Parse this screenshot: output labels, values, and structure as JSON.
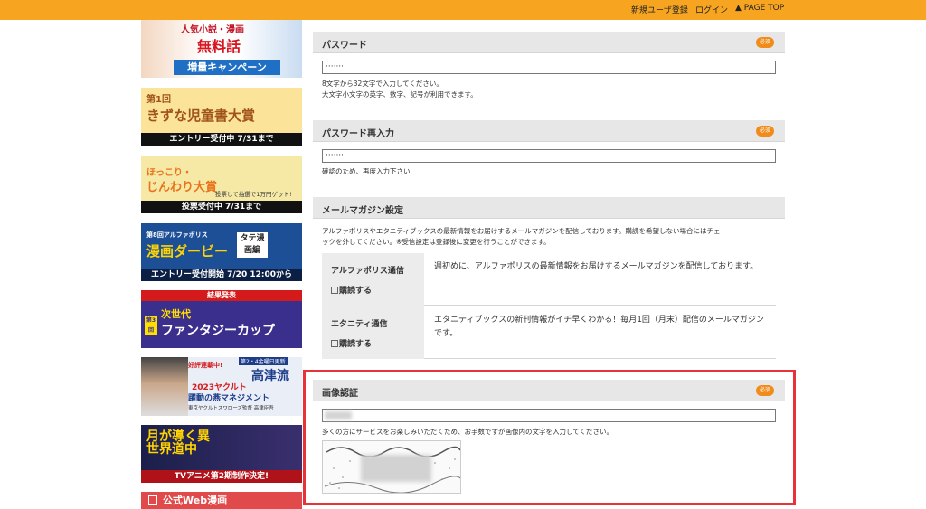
{
  "header": {
    "register": "新規ユーザ登録",
    "login": "ログイン",
    "page_top": "▲ PAGE TOP"
  },
  "sidebar": {
    "banners": [
      {
        "line1": "人気小説・漫画",
        "line2": "無料話",
        "line3": "増量キャンペーン"
      },
      {
        "line1": "第1回",
        "line2": "きずな児童書大賞",
        "footer": "エントリー受付中 7/31まで"
      },
      {
        "line1": "ほっこり・",
        "line2": "じんわり大賞",
        "sub": "投票して抽選で1万円ゲット!",
        "footer": "投票受付中 7/31まで"
      },
      {
        "line1": "第8回アルファポリス",
        "line2": "漫画ダービー",
        "badge": "タテ漫画編",
        "footer": "エントリー受付開始 7/20 12:00から"
      },
      {
        "top": "結果発表",
        "line1": "次世代",
        "line2": "ファンタジーカップ",
        "round": "第3回"
      },
      {
        "line1": "好評連載中!",
        "line2": "2023ヤクルト",
        "line3": "躍動の燕マネジメント",
        "title": "高津流",
        "sub": "東京ヤクルトスワローズ監督 高津臣吾",
        "update": "第2・4金曜日更新"
      },
      {
        "line1": "月が導く異世界道中",
        "footer": "TVアニメ第2期制作決定!"
      }
    ],
    "web_manga": "公式Web漫画"
  },
  "password": {
    "title": "パスワード",
    "required": "必須",
    "value": "········",
    "note1": "8文字から32文字で入力してください。",
    "note2": "大文字小文字の英字、数字、記号が利用できます。"
  },
  "password_confirm": {
    "title": "パスワード再入力",
    "required": "必須",
    "value": "········",
    "note": "確認のため、再度入力下さい"
  },
  "magazine": {
    "title": "メールマガジン設定",
    "desc1": "アルファポリスやエタニティブックスの最新情報をお届けするメールマガジンを配信しております。購読を希望しない場合にはチェ",
    "desc2": "ックを外してください。※受信設定は登録後に変更を行うことができます。",
    "rows": [
      {
        "name": "アルファポリス通信",
        "check": "購読する",
        "desc": "週初めに、アルファポリスの最新情報をお届けするメールマガジンを配信しております。"
      },
      {
        "name": "エタニティ通信",
        "check": "購読する",
        "desc": "エタニティブックスの新刊情報がイチ早くわかる！毎月1回（月末）配信のメールマガジンです。"
      }
    ]
  },
  "captcha": {
    "title": "画像認証",
    "required": "必須",
    "note": "多くの方にサービスをお楽しみいただくため、お手数ですが画像内の文字を入力してください。"
  },
  "colors": {
    "topbar": "#f7a520",
    "required_badge": "#f08c1c",
    "highlight": "#e8323a"
  }
}
